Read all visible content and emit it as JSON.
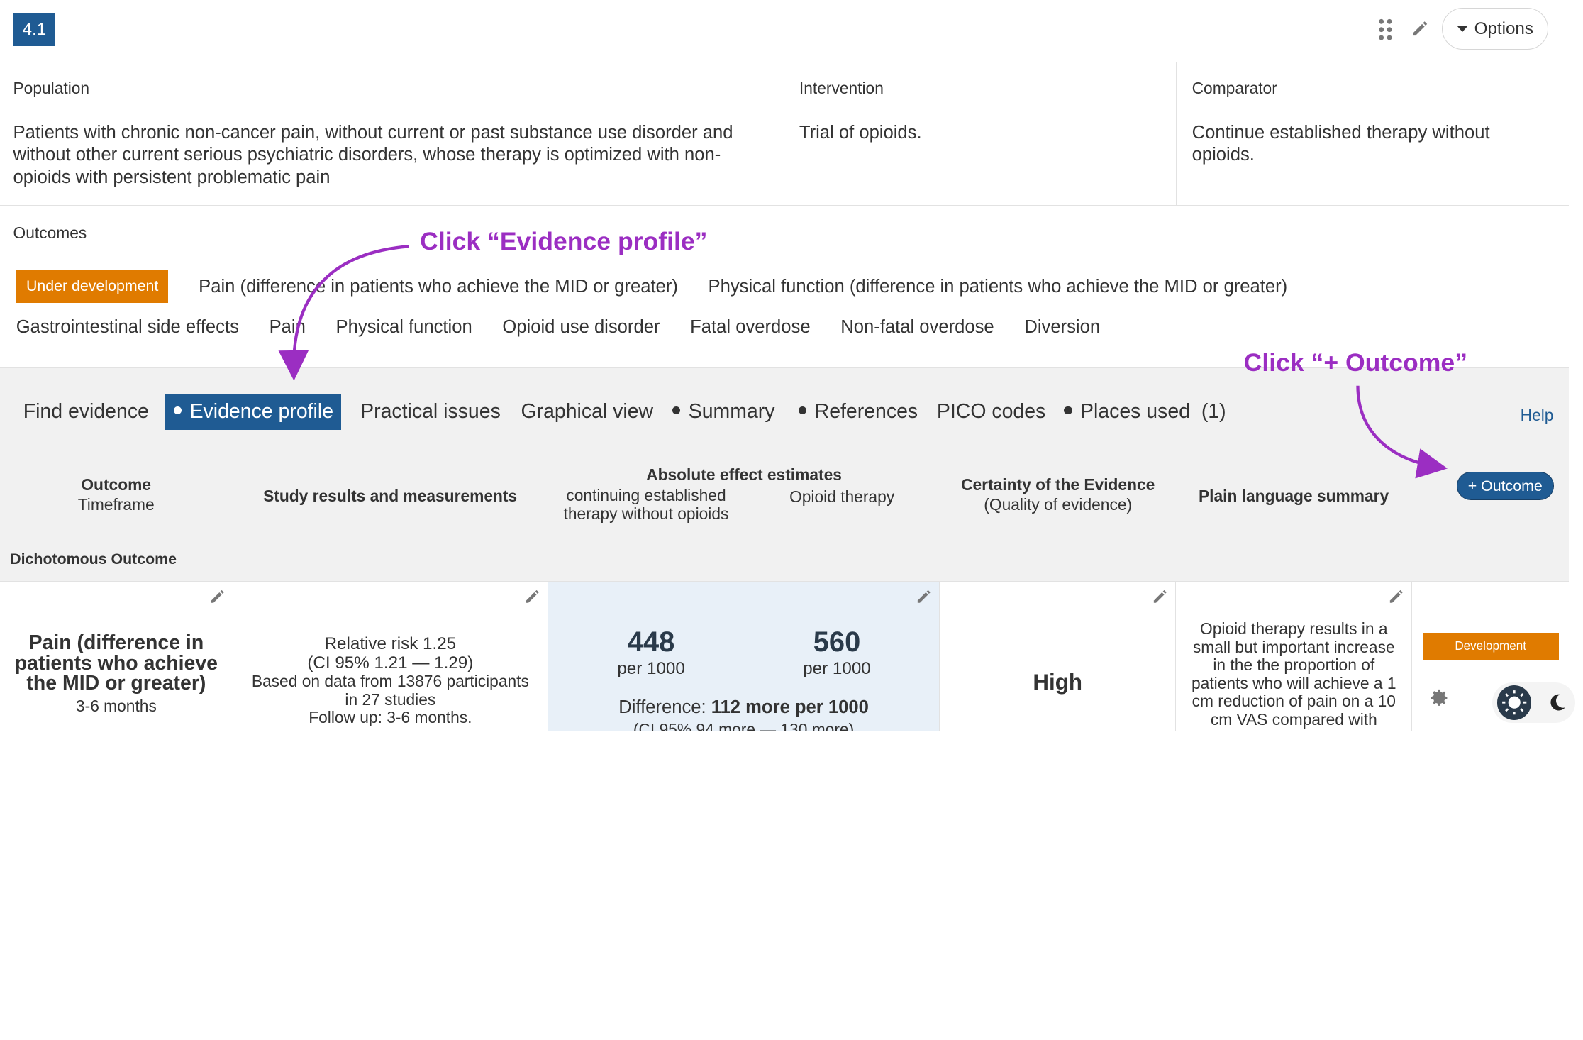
{
  "header": {
    "section_number": "4.1",
    "options_label": "Options"
  },
  "pico": {
    "population_label": "Population",
    "population_text": "Patients with chronic non-cancer pain, without current or past substance use disorder and without other current serious psychiatric disorders, whose therapy is optimized with non-opioids with persistent problematic pain",
    "intervention_label": "Intervention",
    "intervention_text": "Trial of opioids.",
    "comparator_label": "Comparator",
    "comparator_text": "Continue established therapy without opioids."
  },
  "outcomes": {
    "label": "Outcomes",
    "status_badge": "Under development",
    "items_row1": [
      "Pain (difference in patients who achieve the MID or greater)",
      "Physical function (difference in patients who achieve the MID or greater)"
    ],
    "items_row2": [
      "Gastrointestinal side effects",
      "Pain",
      "Physical function",
      "Opioid use disorder",
      "Fatal overdose",
      "Non-fatal overdose",
      "Diversion"
    ]
  },
  "tabs": {
    "find_evidence": "Find evidence",
    "evidence_profile": "Evidence profile",
    "practical_issues": "Practical issues",
    "graphical_view": "Graphical view",
    "summary": "Summary",
    "references": "References",
    "pico_codes": "PICO codes",
    "places_used": "Places used",
    "places_used_count": "(1)",
    "help": "Help"
  },
  "table": {
    "header": {
      "outcome": "Outcome",
      "timeframe": "Timeframe",
      "study_results": "Study results and measurements",
      "absolute_effect": "Absolute effect estimates",
      "comparator_col": "continuing established therapy without opioids",
      "intervention_col": "Opioid therapy",
      "certainty": "Certainty of the Evidence",
      "certainty_sub": "(Quality of evidence)",
      "plain_language": "Plain language summary",
      "add_outcome_button": "+ Outcome"
    },
    "section_title": "Dichotomous Outcome",
    "row": {
      "outcome_name": "Pain (difference in patients who achieve the MID or greater)",
      "timeframe": "3-6 months",
      "relative_risk": "Relative risk 1.25",
      "ci": "(CI 95% 1.21 — 1.29)",
      "based_on": "Based on data from 13876 participants in 27 studies",
      "follow_up": "Follow up: 3-6 months.",
      "comparator_value": "448",
      "comparator_unit": "per 1000",
      "intervention_value": "560",
      "intervention_unit": "per 1000",
      "difference_label": "Difference:",
      "difference_value": "112 more per 1000",
      "difference_ci": "(CI 95% 94 more — 130 more)",
      "certainty": "High",
      "plain_summary": "Opioid therapy results in a small but important increase in the the proportion of patients who will achieve a 1 cm reduction of pain on a 10 cm VAS compared with",
      "status_badge": "Development"
    }
  },
  "annotations": {
    "evidence_profile_hint": "Click “Evidence profile”",
    "add_outcome_hint": "Click “+ Outcome”"
  },
  "colors": {
    "primary": "#1f5b93",
    "warning": "#e07b00",
    "annotation": "#9b2ec2",
    "highlight_cell": "#e8f0f8"
  }
}
